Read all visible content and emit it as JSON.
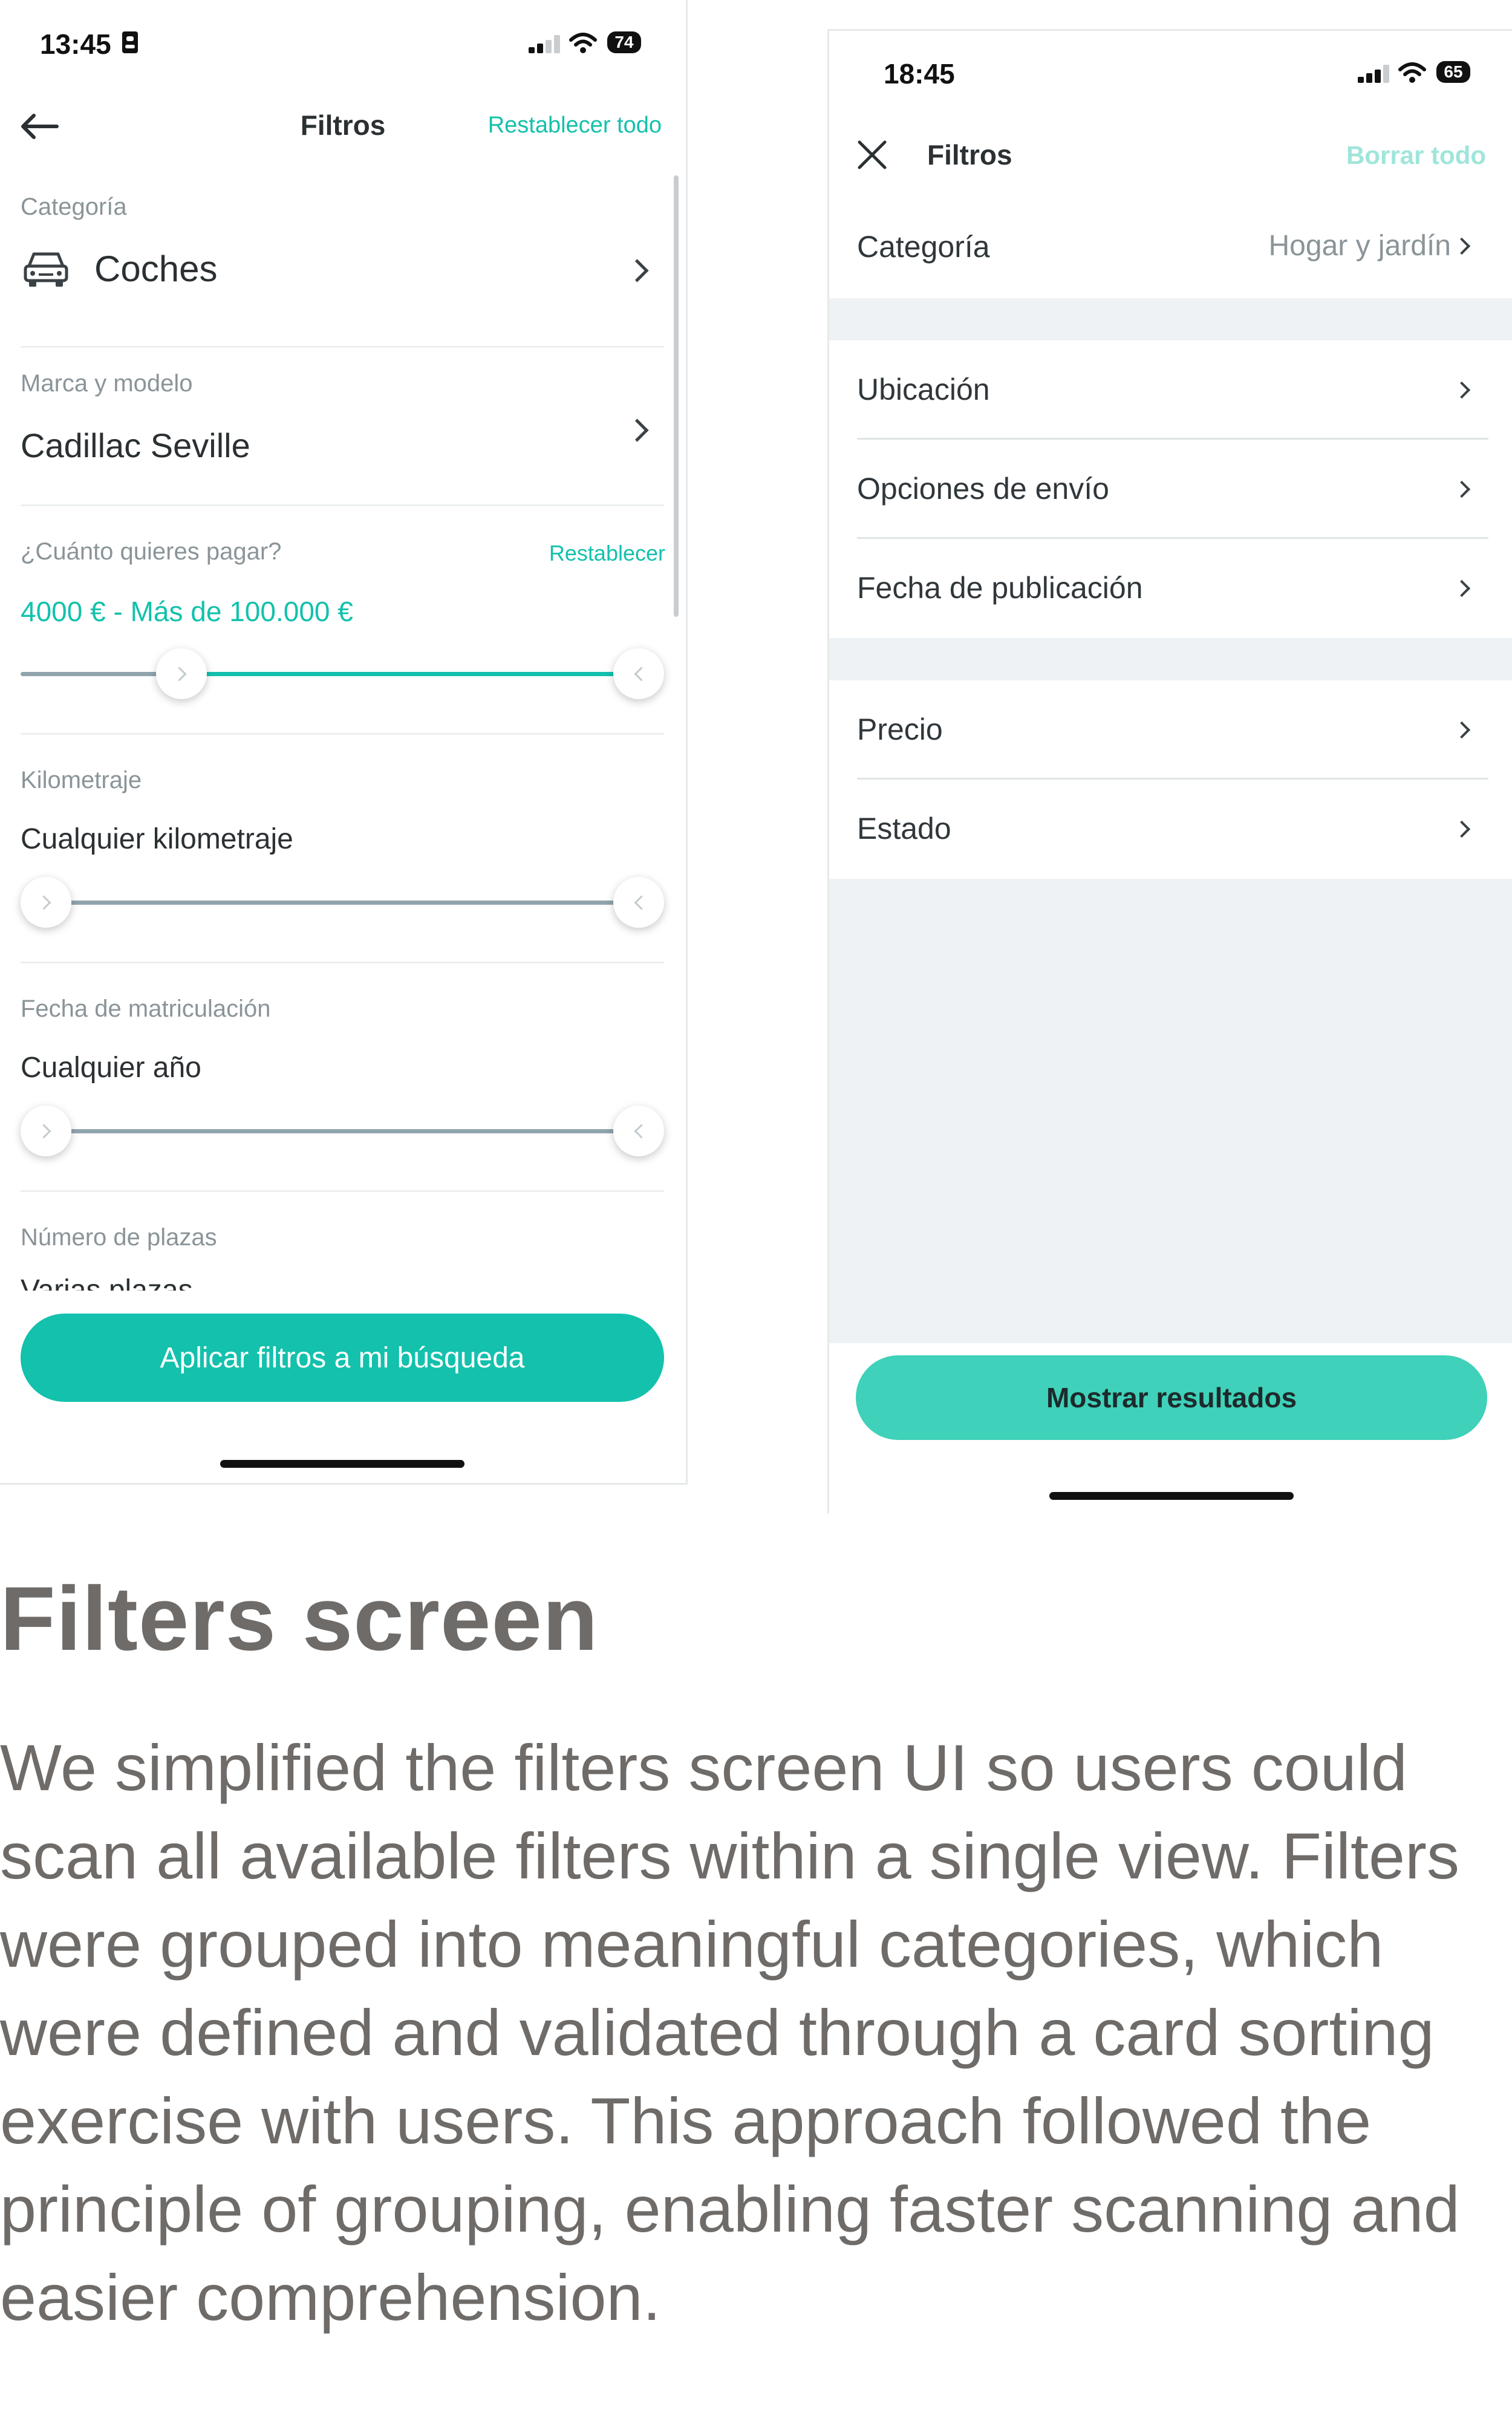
{
  "left_phone": {
    "status_time": "13:45",
    "battery": "74",
    "title": "Filtros",
    "reset_all": "Restablecer todo",
    "category": {
      "label": "Categoría",
      "value": "Coches"
    },
    "brand_model": {
      "label": "Marca y modelo",
      "value": "Cadillac Seville"
    },
    "price": {
      "label": "¿Cuánto quieres pagar?",
      "reset": "Restablecer",
      "value": "4000 € - Más de 100.000 €",
      "range_fraction": [
        0.25,
        1.0
      ]
    },
    "mileage": {
      "label": "Kilometraje",
      "value": "Cualquier kilometraje",
      "range_fraction": [
        0.0,
        1.0
      ]
    },
    "registration": {
      "label": "Fecha de matriculación",
      "value": "Cualquier año",
      "range_fraction": [
        0.0,
        1.0
      ]
    },
    "seats": {
      "label": "Número de plazas",
      "value_partial": "Varias plazas"
    },
    "apply_button": "Aplicar filtros a mi búsqueda",
    "accent_color": "#13c1ac"
  },
  "right_phone": {
    "status_time": "18:45",
    "battery": "65",
    "title": "Filtros",
    "clear_all": "Borrar todo",
    "category": {
      "label": "Categoría",
      "value": "Hogar y jardín"
    },
    "group1": [
      "Ubicación",
      "Opciones de envío",
      "Fecha de publicación"
    ],
    "group2": [
      "Precio",
      "Estado"
    ],
    "results_button": "Mostrar resultados",
    "button_color": "#3fd1b9"
  },
  "article": {
    "heading": "Filters screen",
    "body": "We simplified the filters screen UI so users could scan all available filters within a single view. Filters were grouped into meaningful categories, which were defined and validated through a card sorting exercise with users. This approach followed the principle of grouping, enabling faster scanning and easier comprehension."
  }
}
